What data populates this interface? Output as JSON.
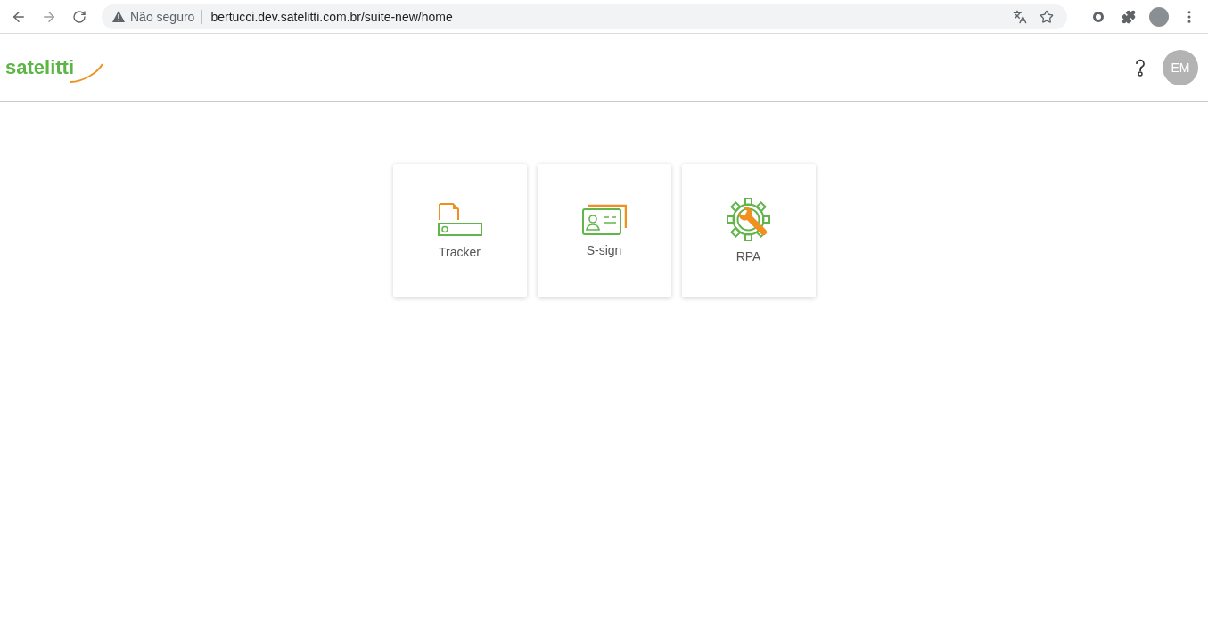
{
  "browser": {
    "security": "Não seguro",
    "url": "bertucci.dev.satelitti.com.br/suite-new/home"
  },
  "header": {
    "logo": "satelitti",
    "avatar": "EM"
  },
  "apps": [
    {
      "kind": "tracker",
      "label": "Tracker"
    },
    {
      "kind": "sign",
      "label": "S-sign"
    },
    {
      "kind": "rpa",
      "label": "RPA"
    }
  ]
}
